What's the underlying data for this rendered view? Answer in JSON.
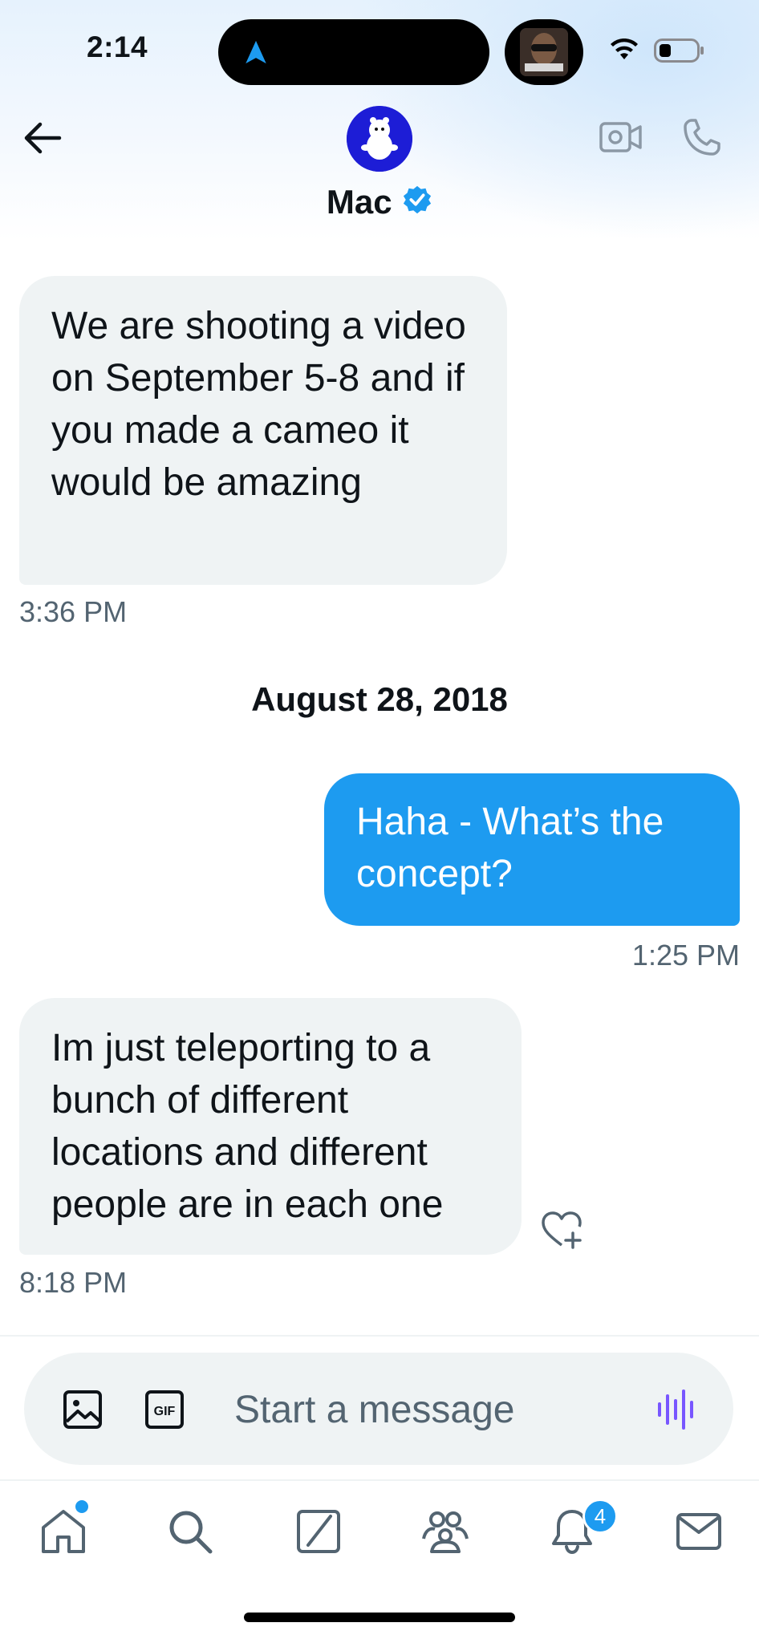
{
  "status_bar": {
    "time": "2:14"
  },
  "header": {
    "name": "Mac",
    "verified": true
  },
  "messages": [
    {
      "direction": "incoming",
      "text": "We are shooting a video on September 5-8 and if you made a cameo it would be amazing",
      "time": "3:36 PM"
    },
    {
      "direction": "outgoing",
      "text": "Haha - What’s the concept?",
      "time": "1:25 PM"
    },
    {
      "direction": "incoming",
      "text": "Im just teleporting to a bunch of different locations and different people are in each one",
      "time": "8:18 PM"
    }
  ],
  "date_separator": "August 28, 2018",
  "composer": {
    "placeholder": "Start a message"
  },
  "tab_bar": {
    "items": [
      "home-icon",
      "search-icon",
      "grok-icon",
      "communities-icon",
      "notifications-icon",
      "messages-icon"
    ],
    "notifications_badge": "4"
  },
  "colors": {
    "accent": "#1d9bf0",
    "bubble_incoming": "#eff3f4",
    "text_secondary": "#536471",
    "voice_icon": "#7856ff"
  }
}
